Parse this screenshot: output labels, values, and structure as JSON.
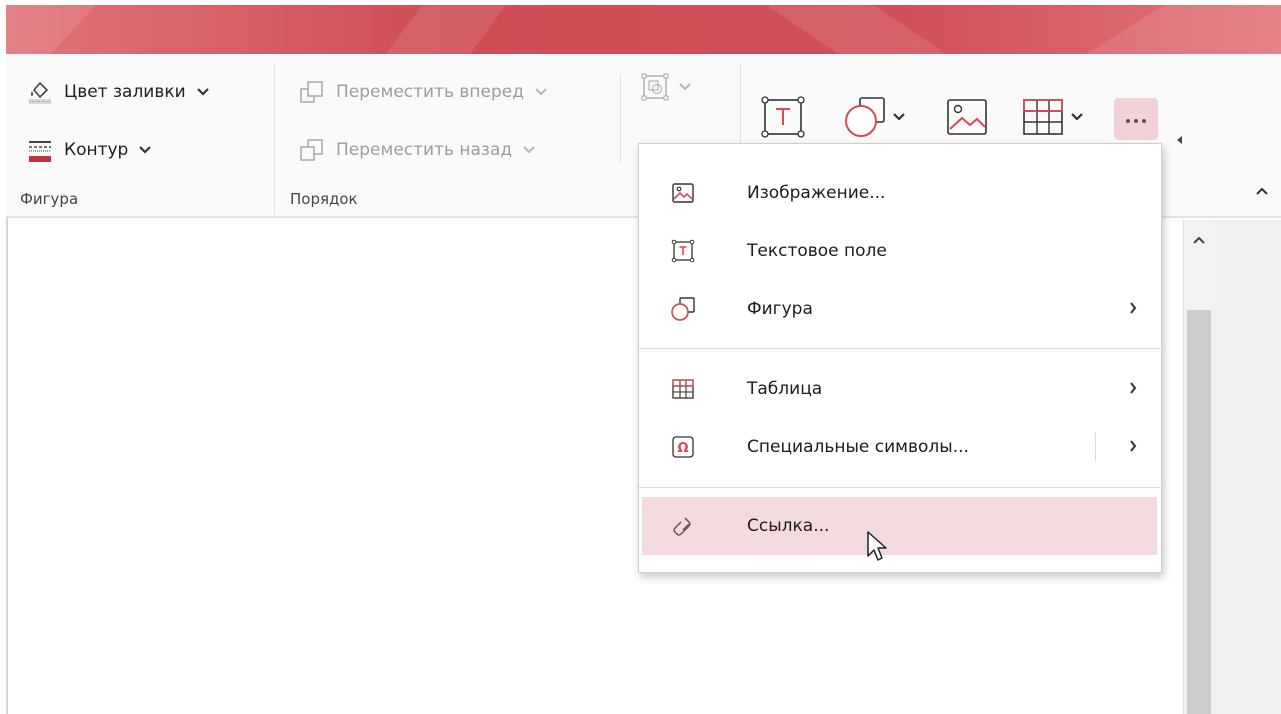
{
  "colors": {
    "accent": "#d24d57",
    "menu_hover": "#f3dade",
    "ribbon_bg": "#fafafa"
  },
  "ribbon": {
    "fill_color_label": "Цвет заливки",
    "outline_label": "Контур",
    "group_shape_label": "Фигура",
    "bring_forward_label": "Переместить вперед",
    "send_backward_label": "Переместить назад",
    "group_order_label": "Порядок"
  },
  "menu": {
    "items": [
      {
        "label": "Изображение...",
        "icon": "image-icon"
      },
      {
        "label": "Текстовое поле",
        "icon": "text-box-icon"
      },
      {
        "label": "Фигура",
        "icon": "shape-icon",
        "submenu": true
      },
      {
        "label": "Таблица",
        "icon": "table-icon",
        "submenu": true
      },
      {
        "label": "Специальные символы...",
        "icon": "omega-icon",
        "submenu": true
      },
      {
        "label": "Ссылка...",
        "icon": "link-icon",
        "hovered": true
      }
    ]
  }
}
